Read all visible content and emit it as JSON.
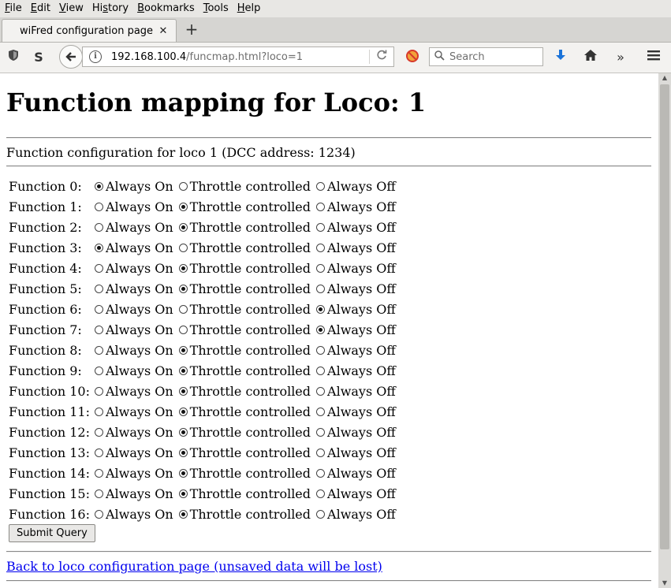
{
  "menubar": {
    "items": [
      {
        "key": "F",
        "rest": "ile"
      },
      {
        "key": "E",
        "rest": "dit"
      },
      {
        "key": "V",
        "rest": "iew"
      },
      {
        "key": "s",
        "pre": "Hi",
        "rest": "tory"
      },
      {
        "key": "B",
        "rest": "ookmarks"
      },
      {
        "key": "T",
        "rest": "ools"
      },
      {
        "key": "H",
        "rest": "elp"
      }
    ]
  },
  "tab": {
    "title": "wiFred configuration page",
    "close": "✕",
    "new": "+"
  },
  "navbar": {
    "url_host": "192.168.100.4",
    "url_path": "/funcmap.html?loco=1",
    "search_placeholder": "Search",
    "icons": [
      "shield-icon",
      "sync-icon",
      "back-icon",
      "info-icon",
      "reload-icon",
      "tracking-blocked-icon",
      "search-icon",
      "download-icon",
      "home-icon",
      "overflow-icon",
      "hamburger-menu-icon"
    ]
  },
  "page": {
    "title": "Function mapping for Loco: 1",
    "description": "Function configuration for loco 1 (DCC address: 1234)",
    "options": [
      "Always On",
      "Throttle controlled",
      "Always Off"
    ],
    "functions": [
      {
        "label": "Function 0:",
        "selected": 0
      },
      {
        "label": "Function 1:",
        "selected": 1
      },
      {
        "label": "Function 2:",
        "selected": 1
      },
      {
        "label": "Function 3:",
        "selected": 0
      },
      {
        "label": "Function 4:",
        "selected": 1
      },
      {
        "label": "Function 5:",
        "selected": 1
      },
      {
        "label": "Function 6:",
        "selected": 2
      },
      {
        "label": "Function 7:",
        "selected": 2
      },
      {
        "label": "Function 8:",
        "selected": 1
      },
      {
        "label": "Function 9:",
        "selected": 1
      },
      {
        "label": "Function 10:",
        "selected": 1
      },
      {
        "label": "Function 11:",
        "selected": 1
      },
      {
        "label": "Function 12:",
        "selected": 1
      },
      {
        "label": "Function 13:",
        "selected": 1
      },
      {
        "label": "Function 14:",
        "selected": 1
      },
      {
        "label": "Function 15:",
        "selected": 1
      },
      {
        "label": "Function 16:",
        "selected": 1
      }
    ],
    "submit_label": "Submit Query",
    "back_link": "Back to loco configuration page (unsaved data will be lost)"
  }
}
